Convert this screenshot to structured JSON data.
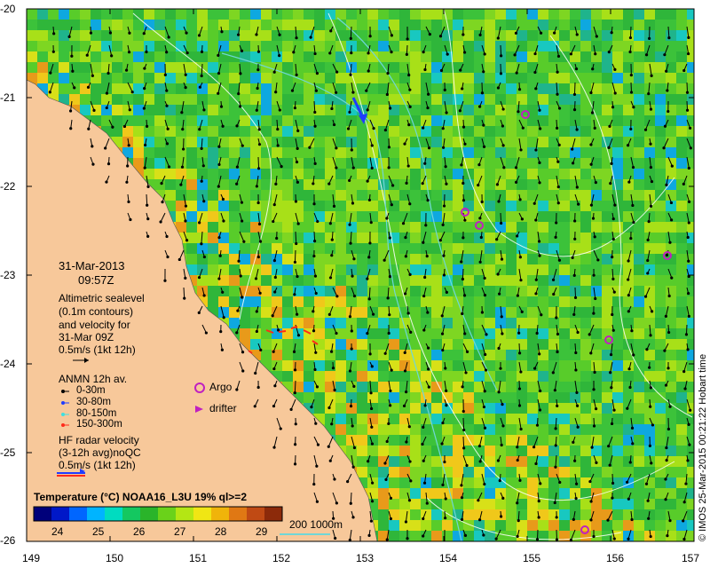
{
  "axes": {
    "lon_ticks": [
      "149",
      "150",
      "151",
      "152",
      "153",
      "154",
      "155",
      "156",
      "157"
    ],
    "lat_ticks": [
      "-20",
      "-21",
      "-22",
      "-23",
      "-24",
      "-25",
      "-26"
    ]
  },
  "panel": {
    "date": "31-Mar-2013",
    "time": "09:57Z",
    "altimetry_lines": [
      "Altimetric sealevel",
      "(0.1m contours)",
      "and velocity for",
      "31-Mar 09Z"
    ],
    "altimetry_scale": "0.5m/s (1kt 12h)",
    "anmn_title": "ANMN 12h av.",
    "anmn_items": [
      {
        "label": "0-30m",
        "color": "#000000"
      },
      {
        "label": "30-80m",
        "color": "#1f3cff"
      },
      {
        "label": "80-150m",
        "color": "#3fe0e0"
      },
      {
        "label": "150-300m",
        "color": "#ff2a1a"
      }
    ],
    "argo_label": "Argo",
    "drifter_label": "drifter",
    "hf_lines": [
      "HF radar velocity",
      "(3-12h avg)noQC",
      "0.5m/s (1kt 12h)"
    ]
  },
  "colorbar": {
    "title": "Temperature (°C) NOAA16_L3U 19% ql>=2",
    "ticks": [
      "24",
      "25",
      "26",
      "27",
      "28",
      "29"
    ],
    "colors": [
      "#00007a",
      "#0018c8",
      "#0066ff",
      "#00b4ff",
      "#00dcc0",
      "#14c860",
      "#2ab42a",
      "#6ad21a",
      "#b4e614",
      "#f0e614",
      "#f0b40a",
      "#e07814",
      "#c04a14",
      "#8c2a0a"
    ]
  },
  "bathy_legend": "200  1000m",
  "credit": "© IMOS 25-Mar-2015 00:21:22 Hobart time",
  "colors": {
    "land": "#f7c89a",
    "ocean_base": "#2fb63a",
    "contour": "#ffffff",
    "bathy": "#6fd7d7",
    "argo": "#c020c0"
  }
}
